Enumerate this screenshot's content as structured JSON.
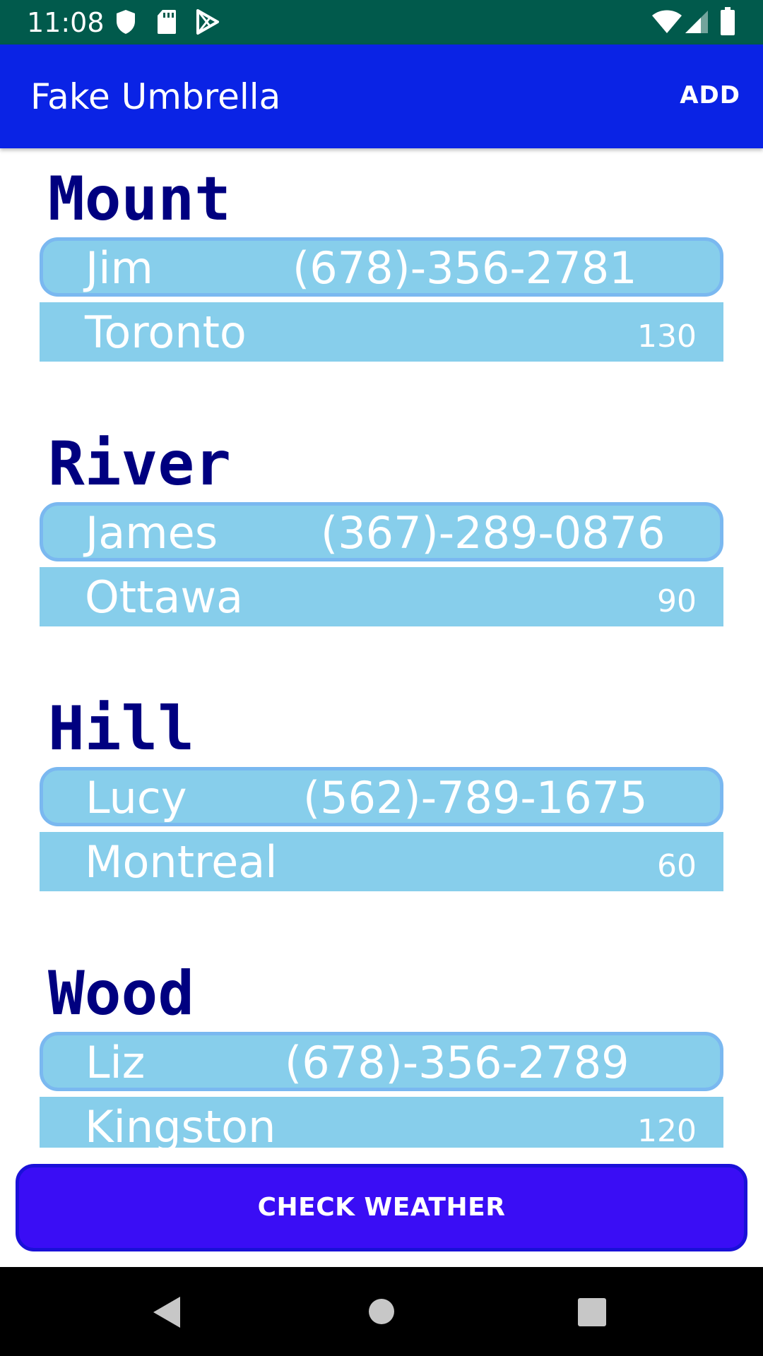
{
  "status_bar": {
    "time": "11:08",
    "icons": [
      "shield-icon",
      "sd-card-icon",
      "play-store-icon",
      "wifi-icon",
      "signal-icon",
      "battery-icon"
    ]
  },
  "app_bar": {
    "title": "Fake Umbrella",
    "add_label": "ADD"
  },
  "contacts": [
    {
      "surname": "Mount",
      "name": "Jim",
      "phone": "(678)-356-2781",
      "city": "Toronto",
      "value": "130"
    },
    {
      "surname": "River",
      "name": "James",
      "phone": "(367)-289-0876",
      "city": "Ottawa",
      "value": "90"
    },
    {
      "surname": "Hill",
      "name": "Lucy",
      "phone": "(562)-789-1675",
      "city": "Montreal",
      "value": "60"
    },
    {
      "surname": "Wood",
      "name": "Liz",
      "phone": "(678)-356-2789",
      "city": "Kingston",
      "value": "120"
    }
  ],
  "check_button_label": "CHECK WEATHER",
  "nav": [
    "back-icon",
    "home-icon",
    "recents-icon"
  ],
  "colors": {
    "status_bar": "#015a4c",
    "app_bar": "#0a23e5",
    "row_fill": "#87ceeb",
    "surname_text": "#000080",
    "button_fill": "#3a0df5"
  }
}
